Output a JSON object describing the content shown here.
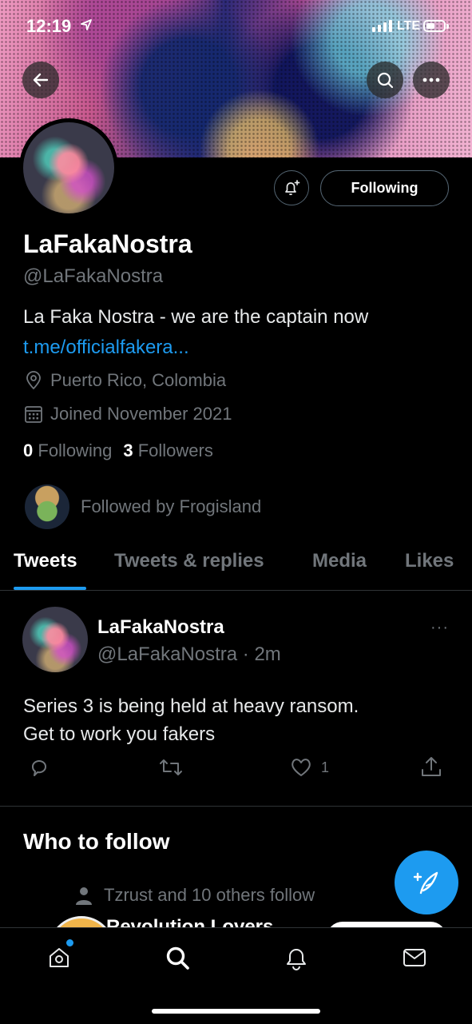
{
  "status_bar": {
    "time": "12:19",
    "network": "LTE"
  },
  "colors": {
    "accent": "#1d9bf0",
    "background": "#000000",
    "secondary_text": "#71767b",
    "border": "#2f3336"
  },
  "profile": {
    "display_name": "LaFakaNostra",
    "handle": "@LaFakaNostra",
    "bio": "La Faka Nostra - we are the captain now",
    "link": "t.me/officialfakera...",
    "location": "Puerto Rico, Colombia",
    "joined": "Joined November 2021",
    "following_count": "0",
    "following_label": "Following",
    "followers_count": "3",
    "followers_label": "Followers",
    "followed_by": "Followed by Frogisland",
    "follow_button_label": "Following"
  },
  "tabs": [
    {
      "label": "Tweets",
      "active": true
    },
    {
      "label": "Tweets & replies",
      "active": false
    },
    {
      "label": "Media",
      "active": false
    },
    {
      "label": "Likes",
      "active": false
    }
  ],
  "tweet": {
    "author_name": "LaFakaNostra",
    "author_handle": "@LaFakaNostra",
    "time": "2m",
    "text_line1": "Series 3 is being held at heavy ransom.",
    "text_line2": "Get to work you fakers",
    "likes": "1",
    "more_label": "···"
  },
  "who_to_follow": {
    "title": "Who to follow",
    "social_context": "Tzrust and 10 others follow",
    "partial_name": "Revolution Lovers"
  },
  "icons": {
    "back": "back-arrow-icon",
    "search": "search-icon",
    "more": "more-icon",
    "bell": "notification-bell-icon",
    "location": "location-pin-icon",
    "calendar": "calendar-icon",
    "reply": "reply-icon",
    "retweet": "retweet-icon",
    "like": "heart-icon",
    "share": "share-icon",
    "compose": "compose-tweet-icon",
    "nav_home": "home-icon",
    "nav_search": "search-icon",
    "nav_notifications": "bell-icon",
    "nav_messages": "mail-icon"
  }
}
